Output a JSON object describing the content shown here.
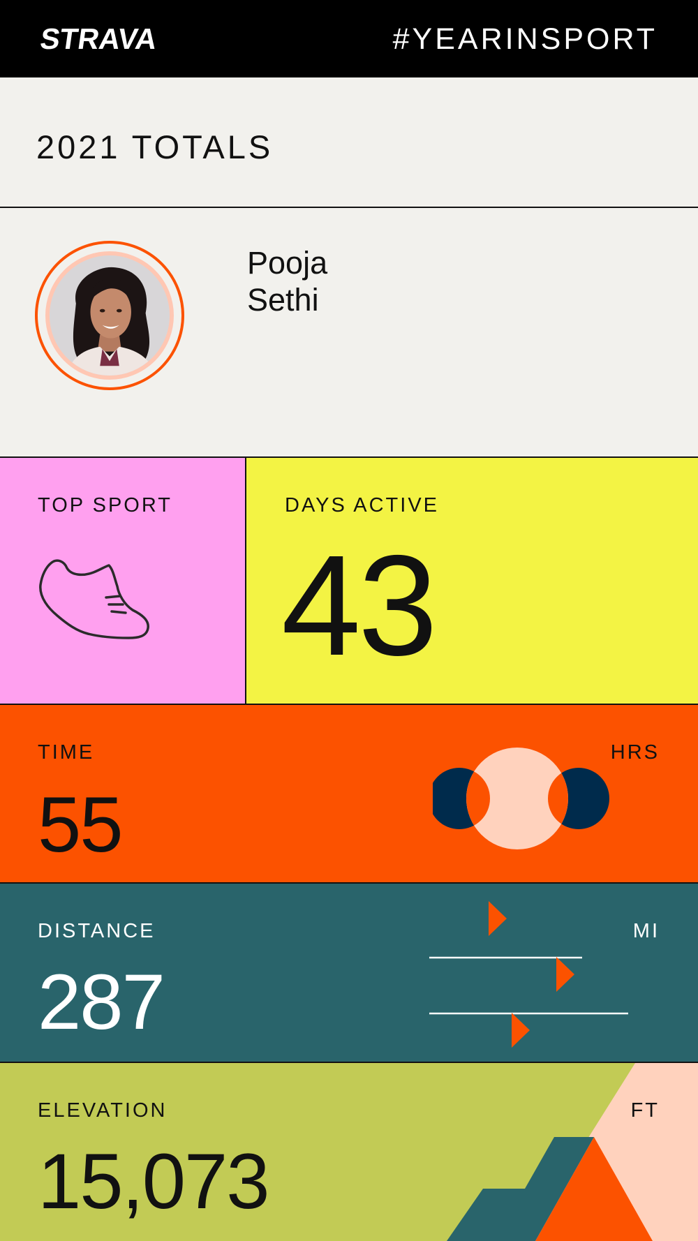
{
  "header": {
    "logo": "STRAVA",
    "hashtag": "#YEARINSPORT"
  },
  "totals_title": "2021 TOTALS",
  "profile": {
    "first_name": "Pooja",
    "last_name": "Sethi"
  },
  "top_sport": {
    "label": "TOP SPORT",
    "icon": "running-shoe-icon"
  },
  "days_active": {
    "label": "DAYS ACTIVE",
    "value": "43"
  },
  "time": {
    "label": "TIME",
    "value": "55",
    "unit": "HRS"
  },
  "distance": {
    "label": "DISTANCE",
    "value": "287",
    "unit": "MI"
  },
  "elevation": {
    "label": "ELEVATION",
    "value": "15,073",
    "unit": "FT"
  },
  "colors": {
    "black": "#000000",
    "background": "#f2f1ed",
    "strava_orange": "#fc5200",
    "pink": "#ffa0ef",
    "yellow": "#f3f344",
    "teal": "#29646b",
    "lime": "#c2cb55",
    "peach": "#ffd2bd",
    "navy": "#002b4c"
  }
}
